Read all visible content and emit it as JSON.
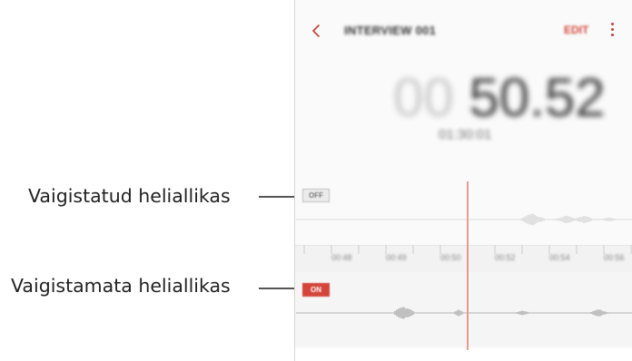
{
  "callouts": {
    "muted_source": "Vaigistatud heliallikas",
    "unmuted_source": "Vaigistamata heliallikas"
  },
  "app_bar": {
    "title": "INTERVIEW 001",
    "edit_label": "EDIT",
    "back_icon": "chevron-left-icon",
    "more_icon": "more-vertical-icon"
  },
  "timer": {
    "minutes": "00",
    "seconds": "50.52",
    "total": "01:30:01"
  },
  "tracks": {
    "muted_tag": "OFF",
    "unmuted_tag": "ON"
  },
  "timeline": {
    "tick_labels": [
      "00:48",
      "00:49",
      "00:50",
      "00:52",
      "00:54",
      "00:56"
    ]
  },
  "colors": {
    "accent": "#d4443a",
    "playhead": "#e05a4f"
  }
}
